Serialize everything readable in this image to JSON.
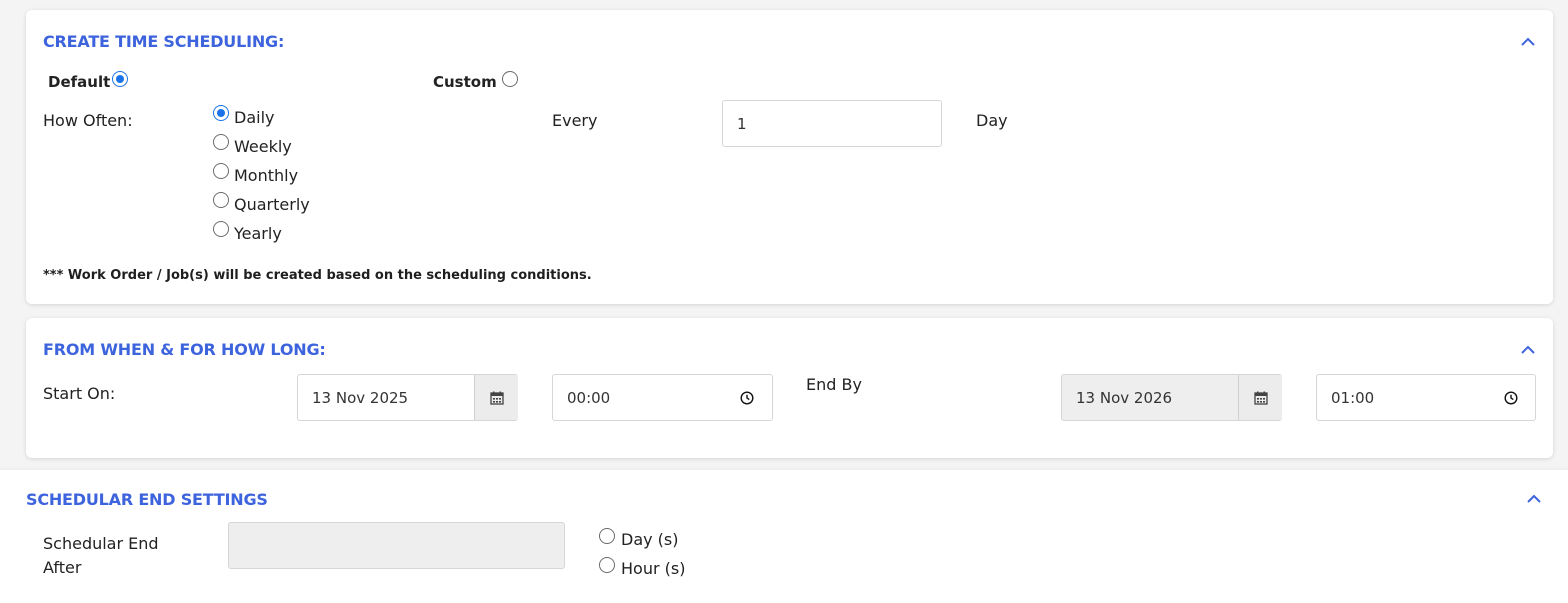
{
  "scheduling": {
    "title": "CREATE TIME SCHEDULING:",
    "default_label": "Default",
    "custom_label": "Custom",
    "how_often_label": "How Often:",
    "options": [
      "Daily",
      "Weekly",
      "Monthly",
      "Quarterly",
      "Yearly"
    ],
    "selected_option": "Daily",
    "mode_selected": "Default",
    "every_label": "Every",
    "every_value": "1",
    "unit_label": "Day",
    "note": "*** Work Order / Job(s) will be created based on the scheduling conditions."
  },
  "duration": {
    "title": "FROM WHEN & FOR HOW LONG:",
    "start_label": "Start On:",
    "start_date": "13 Nov 2025",
    "start_time": "00:00",
    "end_label": "End By",
    "end_date": "13 Nov 2026",
    "end_time": "01:00"
  },
  "end_settings": {
    "title": "SCHEDULAR END SETTINGS",
    "end_after_label_line1": "Schedular End",
    "end_after_label_line2": "After",
    "end_after_value": "",
    "unit_options": [
      "Day (s)",
      "Hour (s)"
    ]
  },
  "colors": {
    "accent": "#3d63dd",
    "radio_selected": "#1a73e8",
    "disabled_field": "#eeeeee"
  },
  "icons": [
    "chevron-up-icon",
    "calendar-icon",
    "clock-icon"
  ]
}
